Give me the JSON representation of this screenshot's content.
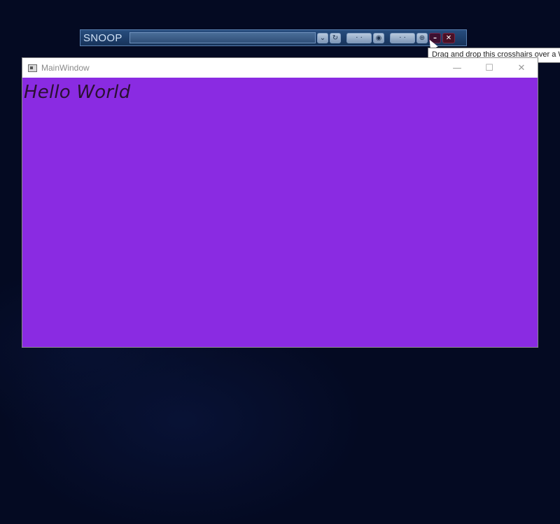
{
  "snoop": {
    "title": "SNOOP",
    "buttons": [
      {
        "name": "dropdown-icon",
        "glyph": "⌄"
      },
      {
        "name": "refresh-icon",
        "glyph": "↻"
      },
      {
        "name": "snoop-action-1",
        "glyph": "·  ·"
      },
      {
        "name": "settings-icon",
        "glyph": "◉"
      },
      {
        "name": "snoop-action-2",
        "glyph": "·  ·"
      },
      {
        "name": "crosshairs-icon",
        "glyph": "⊕"
      },
      {
        "name": "minimize-icon",
        "glyph": "–"
      },
      {
        "name": "close-icon",
        "glyph": "✕"
      }
    ]
  },
  "tooltip": {
    "text": "Drag and drop this crosshairs over a W"
  },
  "main_window": {
    "title": "MainWindow",
    "minimize_glyph": "—",
    "maximize_glyph": "☐",
    "close_glyph": "✕",
    "background_color": "#8a2be2",
    "content_text": "Hello World"
  }
}
